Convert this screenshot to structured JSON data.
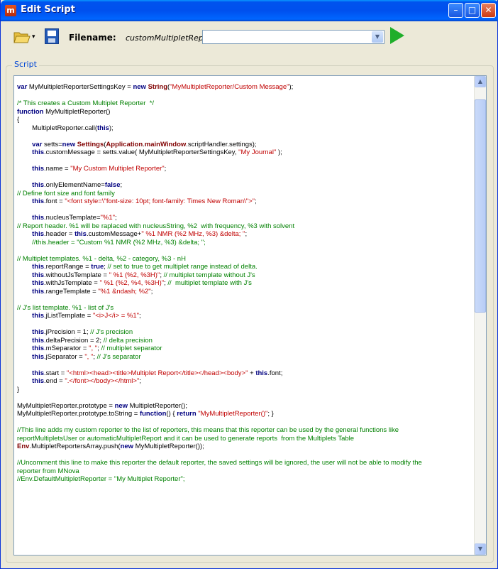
{
  "window": {
    "title": "Edit Script",
    "app_icon_letter": "m",
    "controls": {
      "minimize": "–",
      "maximize": "□",
      "close": "✕"
    }
  },
  "toolbar": {
    "open_icon": "folder-icon",
    "open_dropdown": "▾",
    "save_icon": "save-icon",
    "filename_label": "Filename:",
    "filename_value": "customMultipletReporter.qs",
    "script_combo_value": "",
    "combo_arrow": "▼",
    "run_icon": "play-icon"
  },
  "script_group": {
    "title": "Script"
  },
  "scrollbar": {
    "up": "▲",
    "down": "▼",
    "position": 0.05
  },
  "code_lines": [
    [
      {
        "t": "var",
        "c": "kw"
      },
      {
        "t": " MyMultipletReporterSettingsKey = "
      },
      {
        "t": "new",
        "c": "kw"
      },
      {
        "t": " "
      },
      {
        "t": "String",
        "c": "cls"
      },
      {
        "t": "("
      },
      {
        "t": "\"MyMultipletReporter/Custom Message\"",
        "c": "str"
      },
      {
        "t": ");"
      }
    ],
    [],
    [
      {
        "t": "/* This creates a Custom Multiplet Reporter  */",
        "c": "cmt"
      }
    ],
    [
      {
        "t": "function",
        "c": "kw"
      },
      {
        "t": " MyMultipletReporter()"
      }
    ],
    [
      {
        "t": "{"
      }
    ],
    [
      {
        "t": "        MultipletReporter.call("
      },
      {
        "t": "this",
        "c": "kw"
      },
      {
        "t": ");"
      }
    ],
    [],
    [
      {
        "t": "        "
      },
      {
        "t": "var",
        "c": "kw"
      },
      {
        "t": " setts="
      },
      {
        "t": "new",
        "c": "kw"
      },
      {
        "t": " "
      },
      {
        "t": "Settings",
        "c": "cls"
      },
      {
        "t": "("
      },
      {
        "t": "Application",
        "c": "cls"
      },
      {
        "t": "."
      },
      {
        "t": "mainWindow",
        "c": "cls"
      },
      {
        "t": ".scriptHandler.settings);"
      }
    ],
    [
      {
        "t": "        "
      },
      {
        "t": "this",
        "c": "kw"
      },
      {
        "t": ".customMessage = setts.value( MyMultipletReporterSettingsKey, "
      },
      {
        "t": "\"My Journal\"",
        "c": "str"
      },
      {
        "t": " );"
      }
    ],
    [],
    [
      {
        "t": "        "
      },
      {
        "t": "this",
        "c": "kw"
      },
      {
        "t": ".name = "
      },
      {
        "t": "\"My Custom Multiplet Reporter\"",
        "c": "str"
      },
      {
        "t": ";"
      }
    ],
    [],
    [
      {
        "t": "        "
      },
      {
        "t": "this",
        "c": "kw"
      },
      {
        "t": ".onlyElementName="
      },
      {
        "t": "false",
        "c": "kw"
      },
      {
        "t": ";"
      }
    ],
    [
      {
        "t": "// Define font size and font family",
        "c": "cmt"
      }
    ],
    [
      {
        "t": "        "
      },
      {
        "t": "this",
        "c": "kw"
      },
      {
        "t": ".font = "
      },
      {
        "t": "\"<font style=\\\"font-size: 10pt; font-family: Times New Roman\\\">\"",
        "c": "str"
      },
      {
        "t": ";"
      }
    ],
    [],
    [
      {
        "t": "        "
      },
      {
        "t": "this",
        "c": "kw"
      },
      {
        "t": ".nucleusTemplate="
      },
      {
        "t": "\"%1\"",
        "c": "str"
      },
      {
        "t": ";"
      }
    ],
    [
      {
        "t": "// Report header. %1 will be raplaced with nucleusString, %2  with frequency, %3 with solvent",
        "c": "cmt"
      }
    ],
    [
      {
        "t": "        "
      },
      {
        "t": "this",
        "c": "kw"
      },
      {
        "t": ".header = "
      },
      {
        "t": "this",
        "c": "kw"
      },
      {
        "t": ".customMessage+"
      },
      {
        "t": "\" %1 NMR (%2 MHz, %3) &delta; \"",
        "c": "str"
      },
      {
        "t": ";"
      }
    ],
    [
      {
        "t": "        //this.header = \"Custom %1 NMR (%2 MHz, %3) &delta; \";",
        "c": "cmt"
      }
    ],
    [],
    [
      {
        "t": "// Multiplet templates. %1 - delta, %2 - category, %3 - nH",
        "c": "cmt"
      }
    ],
    [
      {
        "t": "        "
      },
      {
        "t": "this",
        "c": "kw"
      },
      {
        "t": ".reportRange = "
      },
      {
        "t": "true",
        "c": "kw"
      },
      {
        "t": "; "
      },
      {
        "t": "// set to true to get multiplet range instead of delta.",
        "c": "cmt"
      }
    ],
    [
      {
        "t": "        "
      },
      {
        "t": "this",
        "c": "kw"
      },
      {
        "t": ".withoutJsTemplate = "
      },
      {
        "t": "\" %1 (%2, %3H)\"",
        "c": "str"
      },
      {
        "t": "; "
      },
      {
        "t": "// multiplet template without J's",
        "c": "cmt"
      }
    ],
    [
      {
        "t": "        "
      },
      {
        "t": "this",
        "c": "kw"
      },
      {
        "t": ".withJsTemplate = "
      },
      {
        "t": "\" %1 (%2, %4, %3H)\"",
        "c": "str"
      },
      {
        "t": "; "
      },
      {
        "t": "//  multiplet template with J's",
        "c": "cmt"
      }
    ],
    [
      {
        "t": "        "
      },
      {
        "t": "this",
        "c": "kw"
      },
      {
        "t": ".rangeTemplate = "
      },
      {
        "t": "\"%1 &ndash; %2\"",
        "c": "str"
      },
      {
        "t": ";"
      }
    ],
    [],
    [
      {
        "t": "// J's list template. %1 - list of J's",
        "c": "cmt"
      }
    ],
    [
      {
        "t": "        "
      },
      {
        "t": "this",
        "c": "kw"
      },
      {
        "t": ".jListTemplate = "
      },
      {
        "t": "\"<i>J</i> = %1\"",
        "c": "str"
      },
      {
        "t": ";"
      }
    ],
    [],
    [
      {
        "t": "        "
      },
      {
        "t": "this",
        "c": "kw"
      },
      {
        "t": ".jPrecision = 1; "
      },
      {
        "t": "// J's precision",
        "c": "cmt"
      }
    ],
    [
      {
        "t": "        "
      },
      {
        "t": "this",
        "c": "kw"
      },
      {
        "t": ".deltaPrecision = 2; "
      },
      {
        "t": "// delta precision",
        "c": "cmt"
      }
    ],
    [
      {
        "t": "        "
      },
      {
        "t": "this",
        "c": "kw"
      },
      {
        "t": ".mSeparator = "
      },
      {
        "t": "\", \"",
        "c": "str"
      },
      {
        "t": "; "
      },
      {
        "t": "// multiplet separator",
        "c": "cmt"
      }
    ],
    [
      {
        "t": "        "
      },
      {
        "t": "this",
        "c": "kw"
      },
      {
        "t": ".jSeparator = "
      },
      {
        "t": "\", \"",
        "c": "str"
      },
      {
        "t": "; "
      },
      {
        "t": "// J's separator",
        "c": "cmt"
      }
    ],
    [],
    [
      {
        "t": "        "
      },
      {
        "t": "this",
        "c": "kw"
      },
      {
        "t": ".start = "
      },
      {
        "t": "\"<html><head><title>Multiplet Report</title></head><body>\"",
        "c": "str"
      },
      {
        "t": " + "
      },
      {
        "t": "this",
        "c": "kw"
      },
      {
        "t": ".font;"
      }
    ],
    [
      {
        "t": "        "
      },
      {
        "t": "this",
        "c": "kw"
      },
      {
        "t": ".end = "
      },
      {
        "t": "\".</font></body></html>\"",
        "c": "str"
      },
      {
        "t": ";"
      }
    ],
    [
      {
        "t": "}"
      }
    ],
    [],
    [
      {
        "t": "MyMultipletReporter.prototype = "
      },
      {
        "t": "new",
        "c": "kw"
      },
      {
        "t": " MultipletReporter();"
      }
    ],
    [
      {
        "t": "MyMultipletReporter.prototype.toString = "
      },
      {
        "t": "function",
        "c": "kw"
      },
      {
        "t": "() { "
      },
      {
        "t": "return",
        "c": "kw"
      },
      {
        "t": " "
      },
      {
        "t": "\"MyMultipletReporter()\"",
        "c": "str"
      },
      {
        "t": "; }"
      }
    ],
    [],
    [
      {
        "t": "//This line adds my custom reporter to the list of reporters, this means that this reporter can be used by the general functions like",
        "c": "cmt"
      }
    ],
    [
      {
        "t": "reportMultipletsUser or automaticMultipletReport and it can be used to generate reports  from the Multiplets Table",
        "c": "cmt"
      }
    ],
    [
      {
        "t": "Env",
        "c": "cls"
      },
      {
        "t": ".MultipletReportersArray.push("
      },
      {
        "t": "new",
        "c": "kw"
      },
      {
        "t": " MyMultipletReporter());"
      }
    ],
    [],
    [
      {
        "t": "//Uncomment this line to make this reporter the default reporter, the saved settings will be ignored, the user will not be able to modify the",
        "c": "cmt"
      }
    ],
    [
      {
        "t": "reporter from MNova",
        "c": "cmt"
      }
    ],
    [
      {
        "t": "//Env.DefaultMultipletReporter = \"My Multiplet Reporter\";",
        "c": "cmt"
      }
    ]
  ]
}
